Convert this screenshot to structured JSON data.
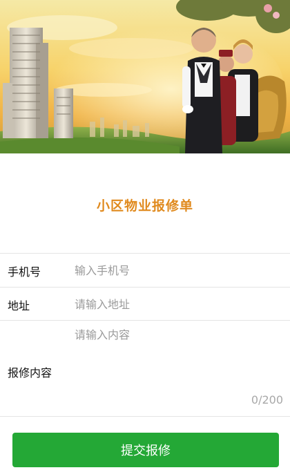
{
  "page": {
    "title": "小区物业报修单"
  },
  "form": {
    "phone": {
      "label": "手机号",
      "placeholder": "输入手机号",
      "value": ""
    },
    "address": {
      "label": "地址",
      "placeholder": "请输入地址",
      "value": ""
    },
    "content": {
      "label": "报修内容",
      "placeholder": "请输入内容",
      "value": "",
      "counter": "0/200"
    }
  },
  "submit": {
    "label": "提交报修"
  },
  "colors": {
    "title": "#e08a1e",
    "submit_bg": "#24a836",
    "divider": "#e4e4e4"
  }
}
